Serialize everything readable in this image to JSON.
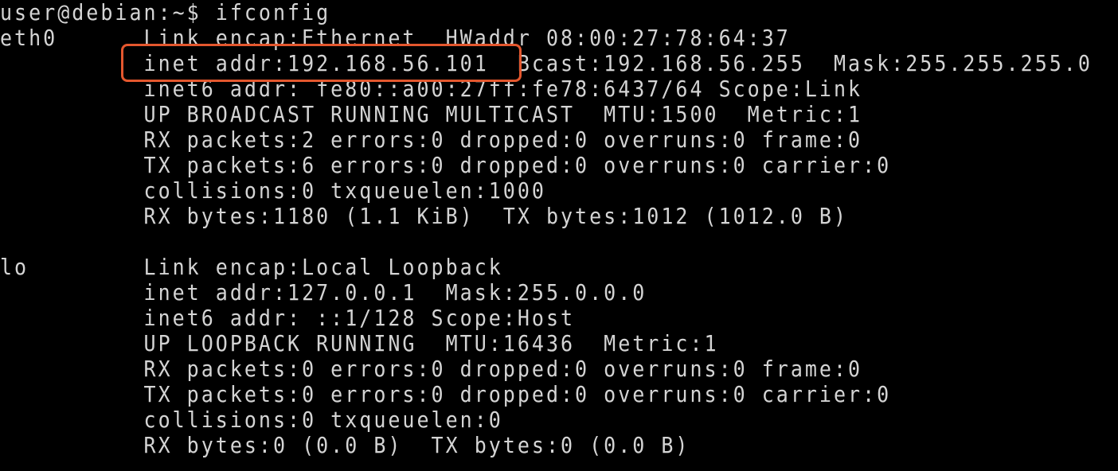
{
  "terminal": {
    "prompt": "user@debian:~$ ifconfig",
    "lines": [
      "eth0      Link encap:Ethernet  HWaddr 08:00:27:78:64:37",
      "          inet addr:192.168.56.101  Bcast:192.168.56.255  Mask:255.255.255.0",
      "          inet6 addr: fe80::a00:27ff:fe78:6437/64 Scope:Link",
      "          UP BROADCAST RUNNING MULTICAST  MTU:1500  Metric:1",
      "          RX packets:2 errors:0 dropped:0 overruns:0 frame:0",
      "          TX packets:6 errors:0 dropped:0 overruns:0 carrier:0",
      "          collisions:0 txqueuelen:1000",
      "          RX bytes:1180 (1.1 KiB)  TX bytes:1012 (1012.0 B)",
      "",
      "lo        Link encap:Local Loopback",
      "          inet addr:127.0.0.1  Mask:255.0.0.0",
      "          inet6 addr: ::1/128 Scope:Host",
      "          UP LOOPBACK RUNNING  MTU:16436  Metric:1",
      "          RX packets:0 errors:0 dropped:0 overruns:0 frame:0",
      "          TX packets:0 errors:0 dropped:0 overruns:0 carrier:0",
      "          collisions:0 txqueuelen:0",
      "          RX bytes:0 (0.0 B)  TX bytes:0 (0.0 B)"
    ]
  },
  "colors": {
    "background": "#000000",
    "text": "#d4d4d4",
    "highlight": "#e4572e"
  }
}
